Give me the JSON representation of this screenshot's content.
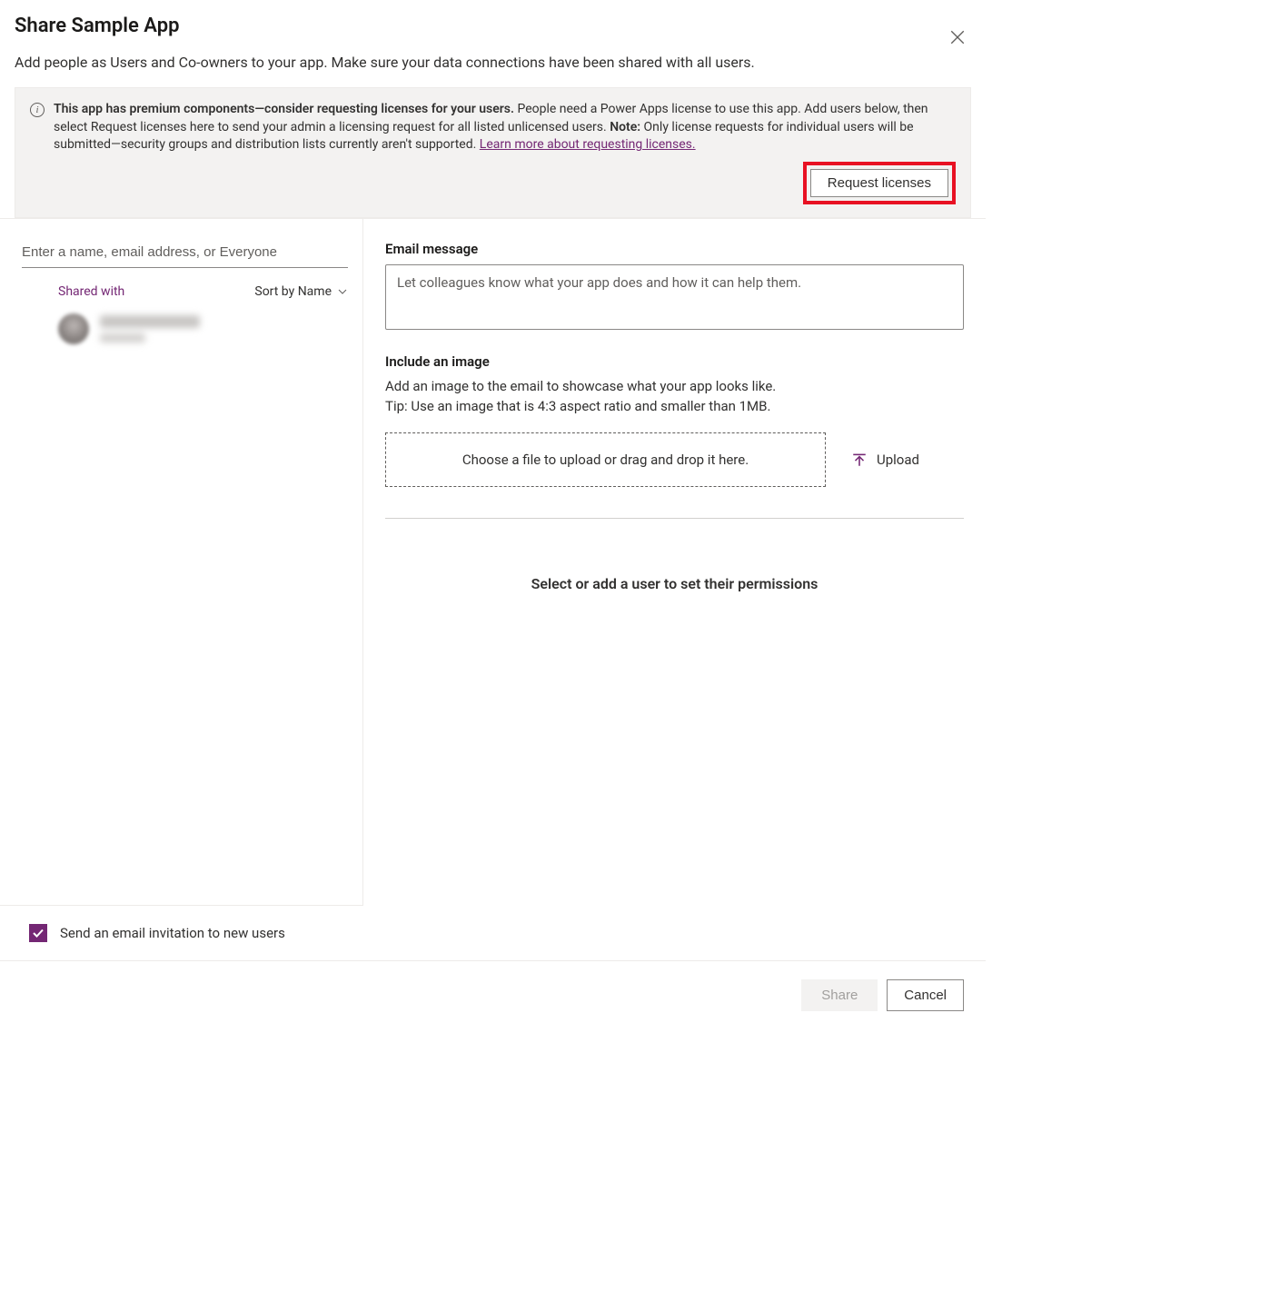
{
  "dialog": {
    "title": "Share Sample App",
    "subtitle": "Add people as Users and Co-owners to your app. Make sure your data connections have been shared with all users."
  },
  "banner": {
    "lead_bold": "This app has premium components—consider requesting licenses for your users.",
    "body_part1": " People need a Power Apps license to use this app. Add users below, then select Request licenses here to send your admin a licensing request for all listed unlicensed users. ",
    "note_label": "Note:",
    "body_part2": " Only license requests for individual users will be submitted—security groups and distribution lists currently aren't supported. ",
    "learn_more": "Learn more about requesting licenses.",
    "action_label": "Request licenses"
  },
  "left": {
    "search_placeholder": "Enter a name, email address, or Everyone",
    "shared_with_label": "Shared with",
    "sort_label": "Sort by Name"
  },
  "right": {
    "email_label": "Email message",
    "email_placeholder": "Let colleagues know what your app does and how it can help them.",
    "image_label": "Include an image",
    "image_help1": "Add an image to the email to showcase what your app looks like.",
    "image_help2": "Tip: Use an image that is 4:3 aspect ratio and smaller than 1MB.",
    "dropzone_text": "Choose a file to upload or drag and drop it here.",
    "upload_label": "Upload",
    "permissions_hint": "Select or add a user to set their permissions"
  },
  "checkbox": {
    "label": "Send an email invitation to new users",
    "checked": true
  },
  "footer": {
    "share_label": "Share",
    "cancel_label": "Cancel"
  }
}
